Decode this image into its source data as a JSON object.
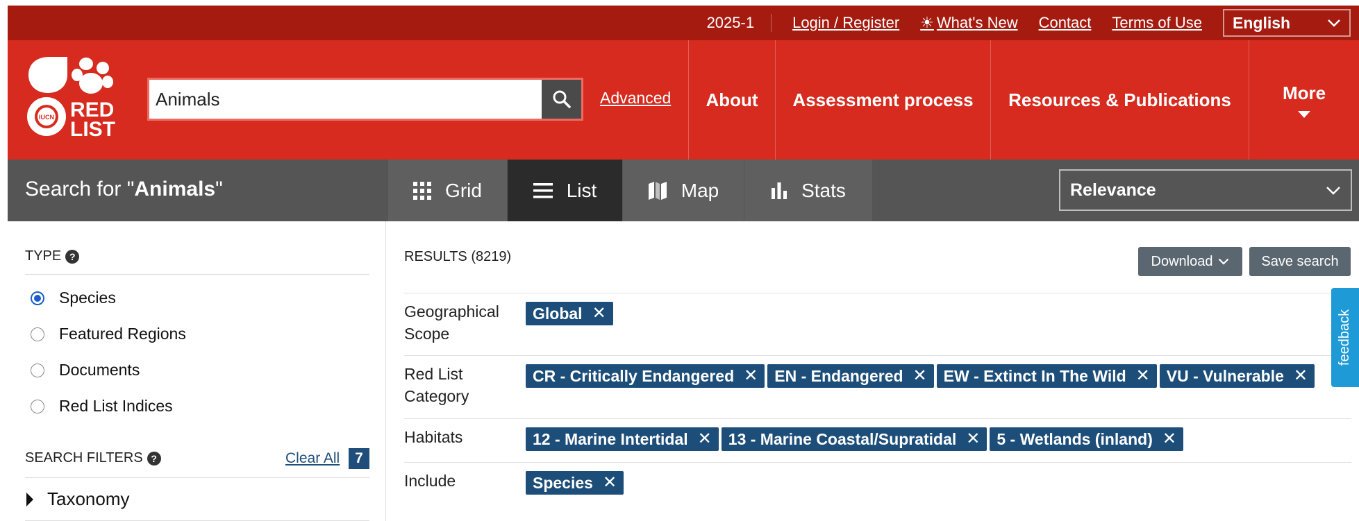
{
  "topbar": {
    "version": "2025-1",
    "login": "Login / Register",
    "whats_new": "What's New",
    "contact": "Contact",
    "terms": "Terms of Use",
    "language": "English"
  },
  "brand": {
    "logo_text_1": "RED",
    "logo_text_2": "LIST",
    "logo_small": "IUCN"
  },
  "search": {
    "value": "Animals",
    "advanced": "Advanced"
  },
  "nav": {
    "about": "About",
    "assessment": "Assessment process",
    "resources": "Resources & Publications",
    "more": "More"
  },
  "searchbar": {
    "prefix": "Search for \"",
    "term": "Animals",
    "suffix": "\"",
    "tabs": [
      "Grid",
      "List",
      "Map",
      "Stats"
    ],
    "active_tab": "List",
    "sort": "Relevance"
  },
  "sidebar": {
    "type_heading": "TYPE",
    "types": [
      "Species",
      "Featured Regions",
      "Documents",
      "Red List Indices"
    ],
    "selected_type": "Species",
    "filters_heading": "SEARCH FILTERS",
    "clear_all": "Clear All",
    "filter_count": "7",
    "taxonomy": "Taxonomy"
  },
  "results": {
    "label": "RESULTS (8219)",
    "download": "Download",
    "save": "Save search",
    "filters": [
      {
        "label_1": "Geographical",
        "label_2": "Scope",
        "chips": [
          "Global"
        ]
      },
      {
        "label_1": "Red List",
        "label_2": "Category",
        "chips": [
          "CR - Critically Endangered",
          "EN - Endangered",
          "EW - Extinct In The Wild",
          "VU - Vulnerable"
        ]
      },
      {
        "label_1": "Habitats",
        "label_2": "",
        "chips": [
          "12 - Marine Intertidal",
          "13 - Marine Coastal/Supratidal",
          "5 - Wetlands (inland)"
        ]
      },
      {
        "label_1": "Include",
        "label_2": "",
        "chips": [
          "Species"
        ]
      }
    ]
  },
  "feedback": "feedback",
  "colors": {
    "topbar": "#a51b10",
    "header": "#d62b1e",
    "dark_bar": "#555555",
    "active_tab": "#2b2b2b",
    "chip": "#1d4e79",
    "feedback": "#1e9bd7"
  }
}
